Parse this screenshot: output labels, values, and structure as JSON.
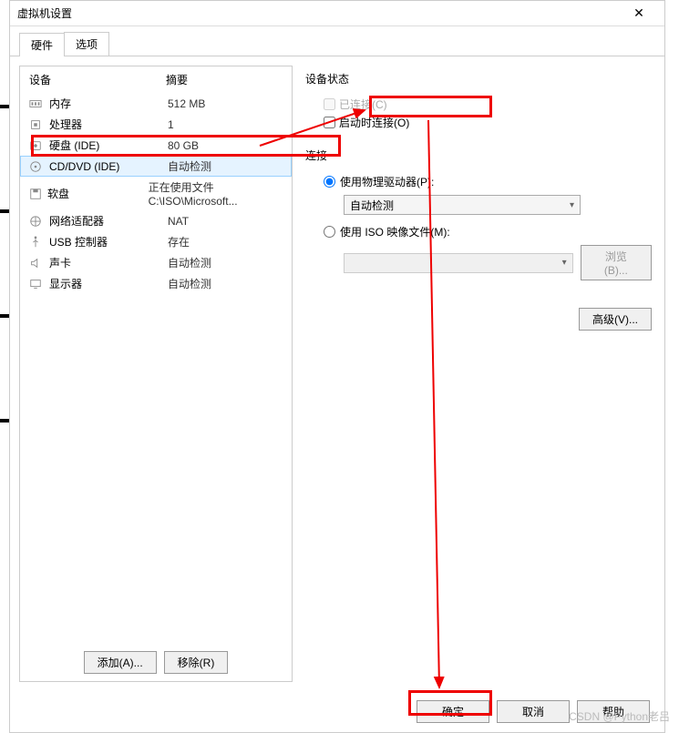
{
  "window": {
    "title": "虚拟机设置",
    "close": "✕"
  },
  "tabs": {
    "hardware": "硬件",
    "options": "选项"
  },
  "hardware": {
    "headers": {
      "device": "设备",
      "summary": "摘要"
    },
    "rows": [
      {
        "name": "内存",
        "summary": "512 MB",
        "icon": "memory"
      },
      {
        "name": "处理器",
        "summary": "1",
        "icon": "cpu"
      },
      {
        "name": "硬盘 (IDE)",
        "summary": "80 GB",
        "icon": "disk"
      },
      {
        "name": "CD/DVD (IDE)",
        "summary": "自动检测",
        "icon": "cd",
        "selected": true
      },
      {
        "name": "软盘",
        "summary": "正在使用文件 C:\\ISO\\Microsoft...",
        "icon": "floppy"
      },
      {
        "name": "网络适配器",
        "summary": "NAT",
        "icon": "net"
      },
      {
        "name": "USB 控制器",
        "summary": "存在",
        "icon": "usb"
      },
      {
        "name": "声卡",
        "summary": "自动检测",
        "icon": "sound"
      },
      {
        "name": "显示器",
        "summary": "自动检测",
        "icon": "display"
      }
    ],
    "add_btn": "添加(A)...",
    "remove_btn": "移除(R)"
  },
  "right": {
    "device_status_label": "设备状态",
    "connected": "已连接(C)",
    "connect_at_poweron": "启动时连接(O)",
    "connection_label": "连接",
    "use_physical": "使用物理驱动器(P):",
    "auto_detect": "自动检测",
    "use_iso": "使用 ISO 映像文件(M):",
    "browse": "浏览(B)...",
    "advanced": "高级(V)..."
  },
  "footer": {
    "ok": "确定",
    "cancel": "取消",
    "help": "帮助"
  },
  "watermark": "CSDN @Python老吕"
}
